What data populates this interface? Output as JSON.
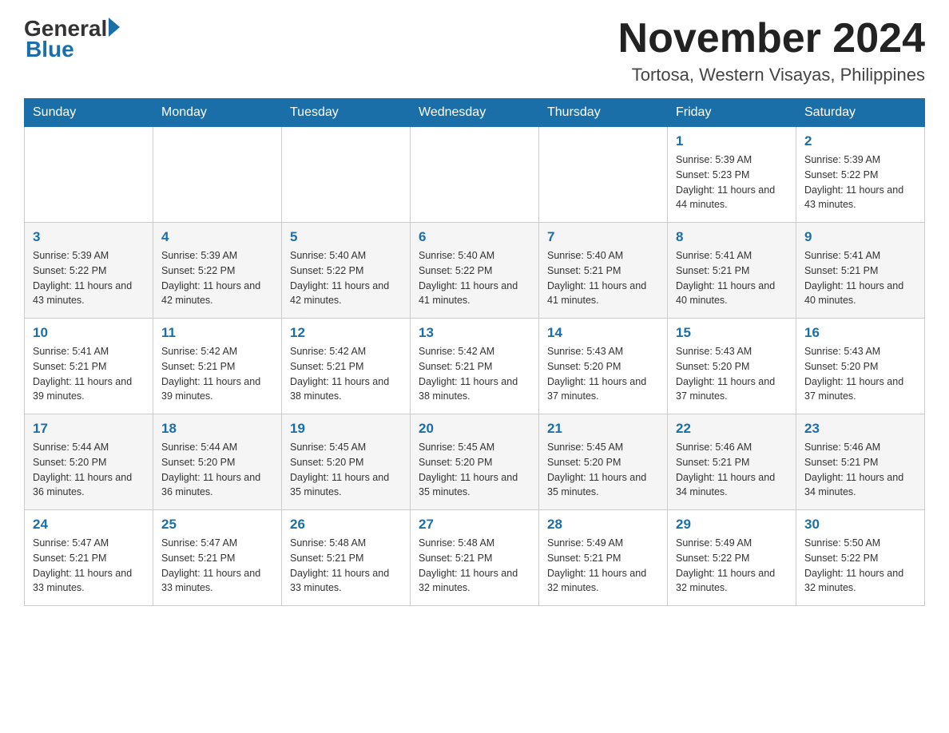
{
  "header": {
    "logo_general": "General",
    "logo_blue": "Blue",
    "month_title": "November 2024",
    "location": "Tortosa, Western Visayas, Philippines"
  },
  "weekdays": [
    "Sunday",
    "Monday",
    "Tuesday",
    "Wednesday",
    "Thursday",
    "Friday",
    "Saturday"
  ],
  "rows": [
    {
      "cells": [
        {
          "day": "",
          "info": ""
        },
        {
          "day": "",
          "info": ""
        },
        {
          "day": "",
          "info": ""
        },
        {
          "day": "",
          "info": ""
        },
        {
          "day": "",
          "info": ""
        },
        {
          "day": "1",
          "info": "Sunrise: 5:39 AM\nSunset: 5:23 PM\nDaylight: 11 hours and 44 minutes."
        },
        {
          "day": "2",
          "info": "Sunrise: 5:39 AM\nSunset: 5:22 PM\nDaylight: 11 hours and 43 minutes."
        }
      ]
    },
    {
      "cells": [
        {
          "day": "3",
          "info": "Sunrise: 5:39 AM\nSunset: 5:22 PM\nDaylight: 11 hours and 43 minutes."
        },
        {
          "day": "4",
          "info": "Sunrise: 5:39 AM\nSunset: 5:22 PM\nDaylight: 11 hours and 42 minutes."
        },
        {
          "day": "5",
          "info": "Sunrise: 5:40 AM\nSunset: 5:22 PM\nDaylight: 11 hours and 42 minutes."
        },
        {
          "day": "6",
          "info": "Sunrise: 5:40 AM\nSunset: 5:22 PM\nDaylight: 11 hours and 41 minutes."
        },
        {
          "day": "7",
          "info": "Sunrise: 5:40 AM\nSunset: 5:21 PM\nDaylight: 11 hours and 41 minutes."
        },
        {
          "day": "8",
          "info": "Sunrise: 5:41 AM\nSunset: 5:21 PM\nDaylight: 11 hours and 40 minutes."
        },
        {
          "day": "9",
          "info": "Sunrise: 5:41 AM\nSunset: 5:21 PM\nDaylight: 11 hours and 40 minutes."
        }
      ]
    },
    {
      "cells": [
        {
          "day": "10",
          "info": "Sunrise: 5:41 AM\nSunset: 5:21 PM\nDaylight: 11 hours and 39 minutes."
        },
        {
          "day": "11",
          "info": "Sunrise: 5:42 AM\nSunset: 5:21 PM\nDaylight: 11 hours and 39 minutes."
        },
        {
          "day": "12",
          "info": "Sunrise: 5:42 AM\nSunset: 5:21 PM\nDaylight: 11 hours and 38 minutes."
        },
        {
          "day": "13",
          "info": "Sunrise: 5:42 AM\nSunset: 5:21 PM\nDaylight: 11 hours and 38 minutes."
        },
        {
          "day": "14",
          "info": "Sunrise: 5:43 AM\nSunset: 5:20 PM\nDaylight: 11 hours and 37 minutes."
        },
        {
          "day": "15",
          "info": "Sunrise: 5:43 AM\nSunset: 5:20 PM\nDaylight: 11 hours and 37 minutes."
        },
        {
          "day": "16",
          "info": "Sunrise: 5:43 AM\nSunset: 5:20 PM\nDaylight: 11 hours and 37 minutes."
        }
      ]
    },
    {
      "cells": [
        {
          "day": "17",
          "info": "Sunrise: 5:44 AM\nSunset: 5:20 PM\nDaylight: 11 hours and 36 minutes."
        },
        {
          "day": "18",
          "info": "Sunrise: 5:44 AM\nSunset: 5:20 PM\nDaylight: 11 hours and 36 minutes."
        },
        {
          "day": "19",
          "info": "Sunrise: 5:45 AM\nSunset: 5:20 PM\nDaylight: 11 hours and 35 minutes."
        },
        {
          "day": "20",
          "info": "Sunrise: 5:45 AM\nSunset: 5:20 PM\nDaylight: 11 hours and 35 minutes."
        },
        {
          "day": "21",
          "info": "Sunrise: 5:45 AM\nSunset: 5:20 PM\nDaylight: 11 hours and 35 minutes."
        },
        {
          "day": "22",
          "info": "Sunrise: 5:46 AM\nSunset: 5:21 PM\nDaylight: 11 hours and 34 minutes."
        },
        {
          "day": "23",
          "info": "Sunrise: 5:46 AM\nSunset: 5:21 PM\nDaylight: 11 hours and 34 minutes."
        }
      ]
    },
    {
      "cells": [
        {
          "day": "24",
          "info": "Sunrise: 5:47 AM\nSunset: 5:21 PM\nDaylight: 11 hours and 33 minutes."
        },
        {
          "day": "25",
          "info": "Sunrise: 5:47 AM\nSunset: 5:21 PM\nDaylight: 11 hours and 33 minutes."
        },
        {
          "day": "26",
          "info": "Sunrise: 5:48 AM\nSunset: 5:21 PM\nDaylight: 11 hours and 33 minutes."
        },
        {
          "day": "27",
          "info": "Sunrise: 5:48 AM\nSunset: 5:21 PM\nDaylight: 11 hours and 32 minutes."
        },
        {
          "day": "28",
          "info": "Sunrise: 5:49 AM\nSunset: 5:21 PM\nDaylight: 11 hours and 32 minutes."
        },
        {
          "day": "29",
          "info": "Sunrise: 5:49 AM\nSunset: 5:22 PM\nDaylight: 11 hours and 32 minutes."
        },
        {
          "day": "30",
          "info": "Sunrise: 5:50 AM\nSunset: 5:22 PM\nDaylight: 11 hours and 32 minutes."
        }
      ]
    }
  ]
}
